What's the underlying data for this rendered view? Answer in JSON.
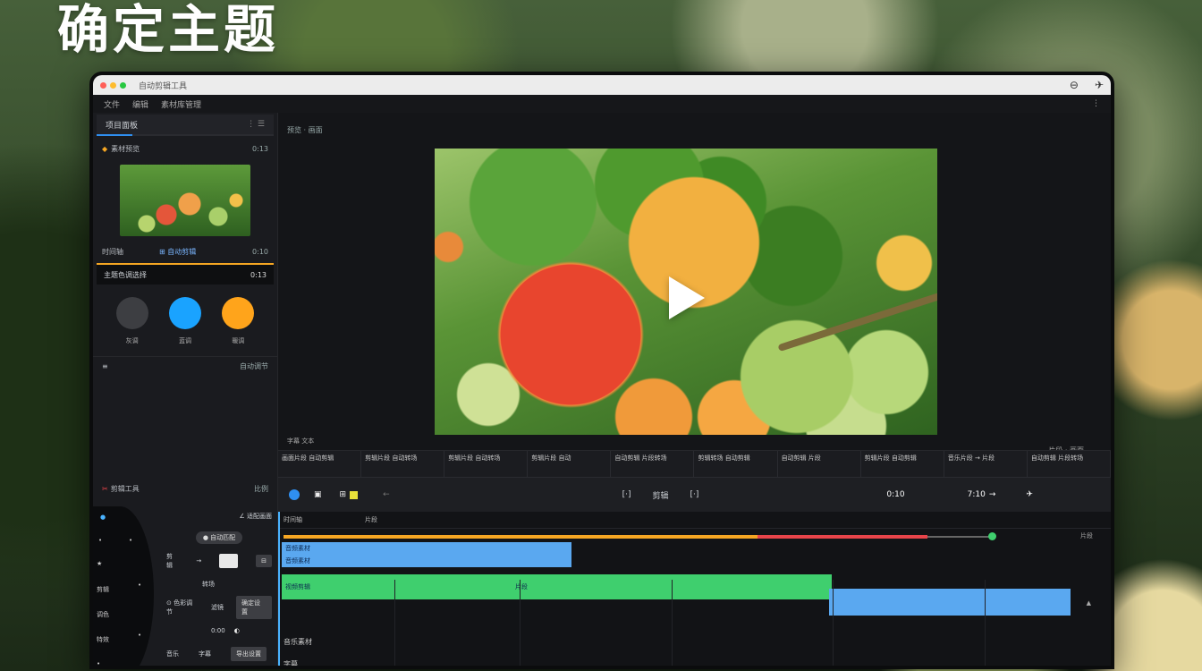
{
  "hero": {
    "title": "确定主题"
  },
  "colors": {
    "accent": "#2f8ff0",
    "amber": "#f5a623",
    "green": "#3fcf6e",
    "red": "#e8444a",
    "clip_blue": "#5aa8f0",
    "swatch_gray": "#3d3e42",
    "swatch_blue": "#1aa3ff",
    "swatch_orange": "#ffa41b"
  },
  "titlebar": {
    "title": "自动剪辑工具",
    "icons": [
      "circle-arrow-icon",
      "paper-plane-icon"
    ]
  },
  "menubar": {
    "items": [
      "文件",
      "编辑",
      "素材库管理"
    ],
    "more": "⋮"
  },
  "left_panel": {
    "header": {
      "label": "项目面板",
      "right": "⋮  ☰"
    },
    "progress": 0.2,
    "media": {
      "label": "素材预览",
      "duration": "0:13"
    },
    "media_meta": {
      "left": "时间轴",
      "mid": "⊞ 自动剪辑",
      "right": "0:10"
    },
    "selected": {
      "label": "主题色调选择",
      "time": "0:13"
    },
    "swatches": [
      {
        "name": "灰调"
      },
      {
        "name": "蓝调"
      },
      {
        "name": "暖调"
      }
    ],
    "swatch_footer": {
      "left": "≡",
      "right": "自动调节"
    },
    "tools": {
      "header": "剪辑工具",
      "header_right": "比例",
      "row1_right": "∠  适配画面",
      "chip": "● 自动匹配",
      "row3_left": "剪辑",
      "row3_mid": "→",
      "row4_left": "转场",
      "row5_left": "⊙ 色彩调节",
      "row5_mid": "滤镜",
      "row5_btn": "确定设置",
      "row6": "0:00",
      "bottom": [
        "音乐",
        "字幕",
        "导出设置"
      ]
    },
    "dial_labels": [
      "•",
      "★",
      "剪辑",
      "调色",
      "特效",
      "•",
      "★",
      "•",
      "•",
      "•"
    ]
  },
  "preview": {
    "label": "预览 · 画面",
    "bottom_left": "字幕  文本",
    "bottom_right": "片段 · 画面",
    "thumbs": [
      "画面片段 自动剪辑",
      "剪辑片段 自动转场",
      "剪辑片段 自动转场",
      "剪辑片段 自动",
      "自动剪辑 片段转场",
      "剪辑转场 自动剪辑",
      "自动剪辑 片段",
      "剪辑片段 自动剪辑",
      "音乐片段 → 片段",
      "自动剪辑 片段转场"
    ]
  },
  "controls": {
    "timecode_a": "[·]",
    "mid": "剪辑",
    "timecode_b": "[·]",
    "duration": "0:10",
    "total": "7:10",
    "arrow": "→"
  },
  "timeline": {
    "ruler": [
      "时间轴",
      "片段"
    ],
    "right_label": "片段",
    "tracks": [
      {
        "label": "音频素材",
        "color": "#5aa8f0"
      },
      {
        "label": "音频素材",
        "color": "#5aa8f0"
      },
      {
        "label": "视频剪辑",
        "color": "#3fcf6e"
      },
      {
        "label": "片段",
        "color": "#3fcf6e"
      },
      {
        "label": "",
        "color": "#5aa8f0"
      }
    ],
    "labels_bottom": [
      "音乐素材",
      "字幕"
    ]
  }
}
